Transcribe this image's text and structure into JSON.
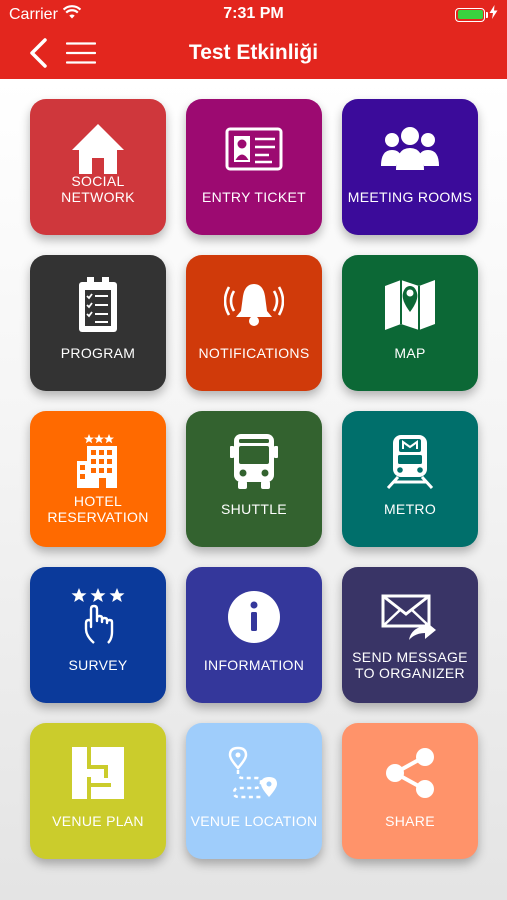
{
  "status_bar": {
    "carrier": "Carrier",
    "time": "7:31 PM"
  },
  "nav": {
    "title": "Test Etkinliği"
  },
  "colors": {
    "header": "#e3261e"
  },
  "tiles": [
    {
      "line1": "SOCIAL NETWORK",
      "line2": "",
      "color": "#cf373c",
      "icon": "home-icon"
    },
    {
      "line1": "ENTRY TICKET",
      "line2": "",
      "color": "#9c0a71",
      "icon": "id-card-icon"
    },
    {
      "line1": "MEETING ROOMS",
      "line2": "",
      "color": "#3b0b9a",
      "icon": "users-icon"
    },
    {
      "line1": "PROGRAM",
      "line2": "",
      "color": "#333333",
      "icon": "checklist-icon"
    },
    {
      "line1": "NOTIFICATIONS",
      "line2": "",
      "color": "#d03a0a",
      "icon": "bell-icon"
    },
    {
      "line1": "MAP",
      "line2": "",
      "color": "#0c6836",
      "icon": "map-icon"
    },
    {
      "line1": "HOTEL",
      "line2": "RESERVATION",
      "color": "#ff6a00",
      "icon": "hotel-icon"
    },
    {
      "line1": "SHUTTLE",
      "line2": "",
      "color": "#33622f",
      "icon": "bus-icon"
    },
    {
      "line1": "METRO",
      "line2": "",
      "color": "#006f6b",
      "icon": "metro-icon"
    },
    {
      "line1": "SURVEY",
      "line2": "",
      "color": "#0b3a9b",
      "icon": "survey-icon"
    },
    {
      "line1": "INFORMATION",
      "line2": "",
      "color": "#34379b",
      "icon": "info-icon"
    },
    {
      "line1": "SEND MESSAGE",
      "line2": "TO ORGANIZER",
      "color": "#393466",
      "icon": "mail-forward-icon"
    },
    {
      "line1": "VENUE PLAN",
      "line2": "",
      "color": "#cbcc2c",
      "icon": "floor-plan-icon"
    },
    {
      "line1": "VENUE LOCATION",
      "line2": "",
      "color": "#9fcdfb",
      "icon": "route-icon"
    },
    {
      "line1": "SHARE",
      "line2": "",
      "color": "#ff936a",
      "icon": "share-icon"
    }
  ]
}
